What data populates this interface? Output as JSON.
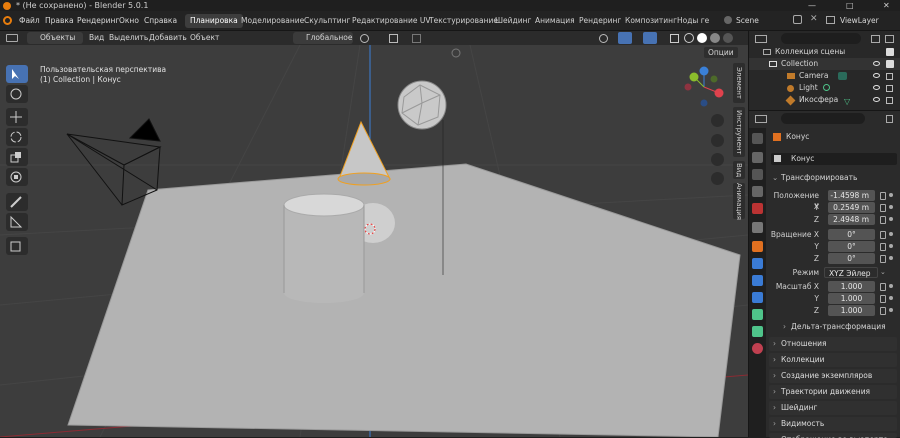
{
  "window": {
    "title": "* (Не сохранено) - Blender 5.0.1",
    "controls": [
      "—",
      "□",
      "✕"
    ]
  },
  "menu": [
    "Файл",
    "Правка",
    "Рендеринг",
    "Окно",
    "Справка"
  ],
  "workspaces": [
    "Планировка",
    "Моделирование",
    "Скульптинг",
    "Редактирование UV",
    "Текстурирование",
    "Шейдинг",
    "Анимация",
    "Рендеринг",
    "Композитинг",
    "Ноды ге"
  ],
  "scene": {
    "label": "Scene",
    "view_layer": "ViewLayer"
  },
  "header": {
    "mode": "Объекты",
    "view": "Вид",
    "select": "Выделить",
    "add": "Добавить",
    "object": "Объект",
    "orientation": "Глобальное",
    "options": "Опции"
  },
  "viewport": {
    "perspective": "Пользовательская перспектива",
    "collection": "(1) Collection | Конус"
  },
  "side_tabs": [
    "Элемент",
    "Инструмент",
    "Вид",
    "Анимация"
  ],
  "outliner": {
    "search_placeholder": "",
    "items": [
      "Коллекция сцены",
      "Collection",
      "Camera",
      "Light",
      "Икосфера",
      "Конус"
    ]
  },
  "properties": {
    "object_name": "Конус",
    "object_data": "Конус",
    "transform_title": "Трансформировать",
    "location": {
      "label_x": "Положение X",
      "x": "-1.4598 m",
      "y": "0.2549 m",
      "z": "2.4948 m"
    },
    "rotation": {
      "label_x": "Вращение X",
      "x": "0°",
      "y": "0°",
      "z": "0°"
    },
    "mode": {
      "label": "Режим",
      "value": "XYZ Эйлер"
    },
    "scale": {
      "label_x": "Масштаб X",
      "x": "1.000",
      "y": "1.000",
      "z": "1.000"
    },
    "axis": {
      "y": "Y",
      "z": "Z"
    },
    "delta": "Дельта-трансформация",
    "panels": [
      "Отношения",
      "Коллекции",
      "Создание экземпляров",
      "Траектории движения",
      "Шейдинг",
      "Видимость",
      "Отображение во вьюпорте"
    ]
  },
  "colors": {
    "accent": "#4772b3",
    "viewport_bg": "#3d3d3d",
    "x_axis": "#e0424d",
    "y_axis": "#8bbd2c",
    "z_axis": "#3a80d8"
  }
}
